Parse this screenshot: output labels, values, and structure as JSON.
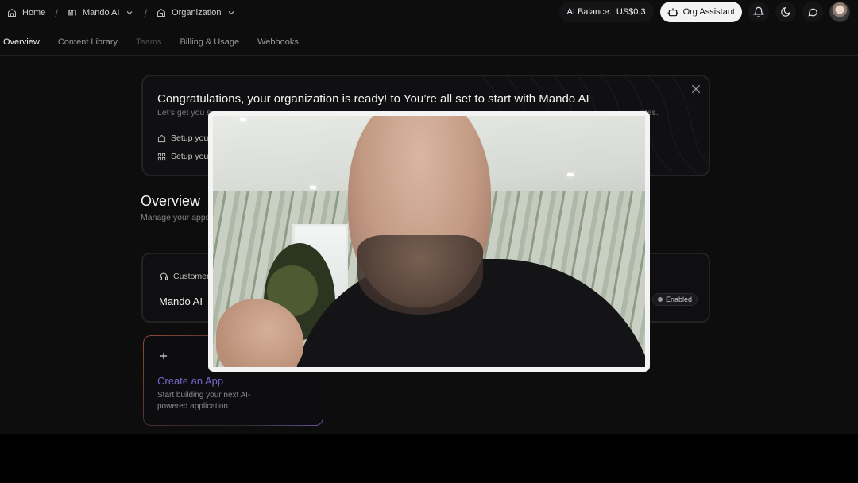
{
  "breadcrumb": {
    "home": "Home",
    "app": "Mando AI",
    "org": "Organization"
  },
  "header": {
    "balance": "AI Balance:  US$0.3",
    "org_assistant": "Org Assistant"
  },
  "tabs": [
    {
      "label": "Overview",
      "state": "active"
    },
    {
      "label": "Content Library",
      "state": "normal"
    },
    {
      "label": "Teams",
      "state": "disabled"
    },
    {
      "label": "Billing & Usage",
      "state": "normal"
    },
    {
      "label": "Webhooks",
      "state": "normal"
    }
  ],
  "banner": {
    "title": "Congratulations, your organization is ready! to You’re all set to start with Mando AI",
    "subtitle_start": "Let’s get you s",
    "subtitle_end": "utes.",
    "setup_items": [
      "Setup you",
      "Setup you"
    ]
  },
  "overview": {
    "title": "Overview",
    "subtitle": "Manage your apps"
  },
  "app_card": {
    "category": "Customer",
    "name": "Mando AI",
    "status": "Enabled"
  },
  "create_card": {
    "title": "Create an App",
    "subtitle": "Start building your next AI-powered application"
  },
  "colors": {
    "accent": "#7a64c8",
    "background": "#0d0d0e"
  },
  "icons": [
    "home-icon",
    "mando-logo-icon",
    "chevron-down-icon",
    "building-icon",
    "assistant-icon",
    "bell-icon",
    "moon-icon",
    "chat-icon",
    "close-icon",
    "grid-icon",
    "headset-icon",
    "plus-icon"
  ]
}
